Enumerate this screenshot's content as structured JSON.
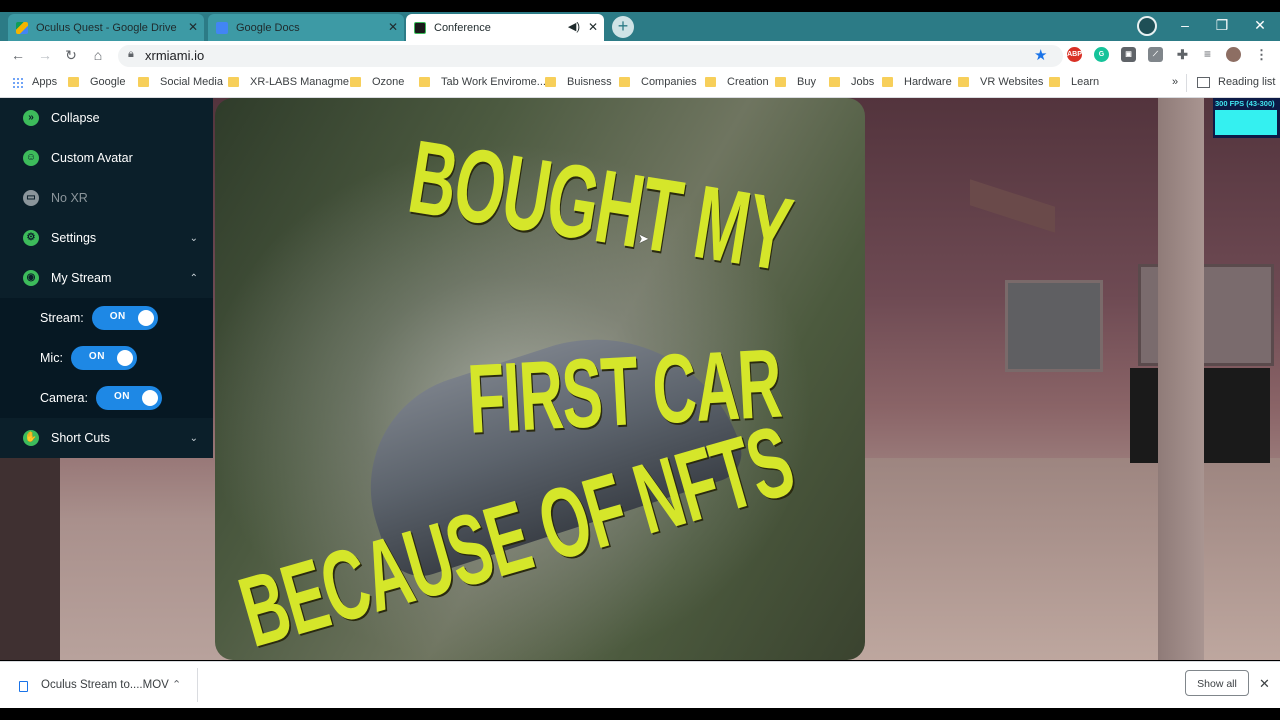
{
  "browser": {
    "tabs": [
      {
        "label": "Oculus Quest - Google Drive",
        "active": false
      },
      {
        "label": "Google Docs",
        "active": false
      },
      {
        "label": "Conference",
        "active": true
      }
    ],
    "url": "xrmiami.io",
    "window_controls": {
      "minimize": "–",
      "maximize": "❐",
      "close": "✕"
    },
    "accent_color": "#2c7b86"
  },
  "bookmarks": {
    "apps_label": "Apps",
    "items": [
      "Google",
      "Social Media",
      "XR-LABS Managme...",
      "Ozone",
      "Tab Work Envirome...",
      "Buisness",
      "Companies",
      "Creation",
      "Buy",
      "Jobs",
      "Hardware",
      "VR Websites",
      "Learn"
    ],
    "overflow": "»",
    "reading_list": "Reading list"
  },
  "sidebar": {
    "items": [
      {
        "label": "Collapse",
        "icon": "collapse-icon"
      },
      {
        "label": "Custom Avatar",
        "icon": "avatar-icon"
      },
      {
        "label": "No XR",
        "icon": "vr-headset-icon",
        "disabled": true
      },
      {
        "label": "Settings",
        "icon": "gear-icon",
        "expandable": true
      },
      {
        "label": "My Stream",
        "icon": "stream-icon",
        "expanded": true
      },
      {
        "label": "Short Cuts",
        "icon": "shortcut-icon",
        "expandable": true
      }
    ],
    "stream_controls": [
      {
        "label": "Stream:",
        "state": "ON"
      },
      {
        "label": "Mic:",
        "state": "ON"
      },
      {
        "label": "Camera:",
        "state": "ON"
      }
    ],
    "toggle_color": "#1e88e5",
    "icon_color": "#3dbb5b"
  },
  "scene": {
    "billboard_lines": [
      "BOUGHT MY",
      "FIRST CAR",
      "BECAUSE OF NFTS"
    ],
    "billboard_text_color": "#d5e62a",
    "fps_label": "300 FPS (43-300)"
  },
  "download_shelf": {
    "file_name": "Oculus Stream to....MOV",
    "show_all": "Show all"
  }
}
